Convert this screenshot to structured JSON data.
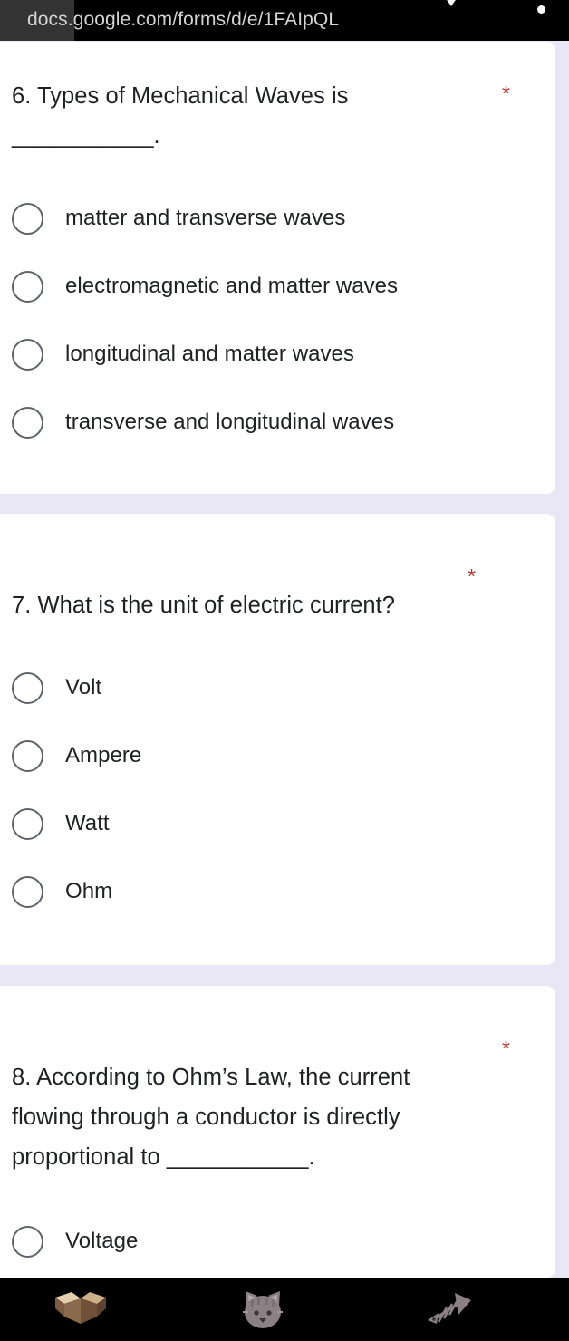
{
  "browser": {
    "url": "docs.google.com/forms/d/e/1FAIpQL",
    "chevron_icon": "chevron-down-icon",
    "dot_icon": "record-dot-icon"
  },
  "form": {
    "required_marker": "*",
    "accent_required_color": "#c5372c",
    "page_background": "#e9e7f5",
    "card_background": "#ffffff",
    "questions": [
      {
        "number": "6.",
        "text": "6. Types of Mechanical Waves is ___________.",
        "line1": "6. Types of Mechanical Waves is",
        "line2": "___________.",
        "required": "*",
        "options": [
          "matter and transverse waves",
          "electromagnetic and matter waves",
          "longitudinal and matter waves",
          "transverse and longitudinal waves"
        ]
      },
      {
        "number": "7.",
        "text": "7. What is the unit of electric current?",
        "line1": "7. What is the unit of electric current?",
        "required": "*",
        "options": [
          "Volt",
          "Ampere",
          "Watt",
          "Ohm"
        ]
      },
      {
        "number": "8.",
        "text": "8. According to Ohm’s Law, the current flowing through a conductor is directly proportional to ___________.",
        "line1": "8. According to Ohm’s Law, the current",
        "line2": "flowing through a conductor is directly",
        "line3": "proportional to ___________.",
        "required": "*",
        "options": [
          "Voltage"
        ]
      }
    ]
  },
  "navbar": {
    "background": "#000000",
    "buttons": [
      {
        "name": "back",
        "icon": "open-box-icon"
      },
      {
        "name": "home",
        "icon": "cat-face-icon"
      },
      {
        "name": "recents",
        "icon": "fish-bone-icon"
      }
    ]
  }
}
